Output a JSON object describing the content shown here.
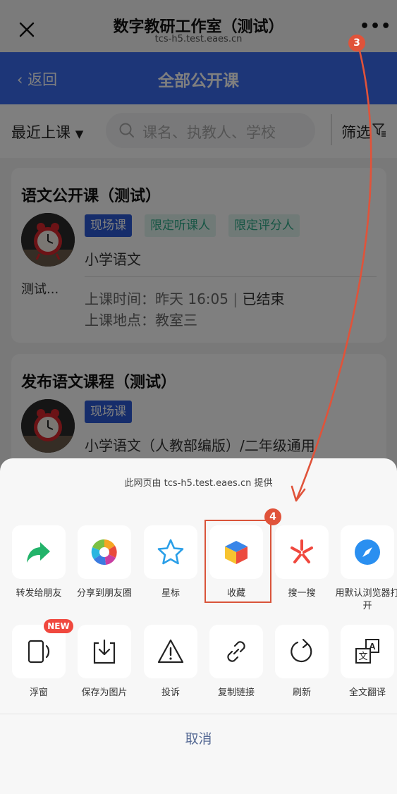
{
  "window": {
    "title": "数字教研工作室（测试）",
    "url": "tcs-h5.test.eaes.cn"
  },
  "header": {
    "back_label": "返回",
    "title": "全部公开课"
  },
  "filter_bar": {
    "sort_label": "最近上课",
    "search_placeholder": "课名、执教人、学校",
    "filter_label": "筛选"
  },
  "courses": [
    {
      "title": "语文公开课（测试）",
      "tags": [
        "现场课",
        "限定听课人",
        "限定评分人"
      ],
      "subject": "小学语文",
      "teacher": "测试...",
      "time_label": "上课时间：",
      "time_value": "昨天 16:05",
      "status": "已结束",
      "location_label": "上课地点：",
      "location_value": "教室三"
    },
    {
      "title": "发布语文课程（测试）",
      "tags": [
        "现场课"
      ],
      "subject": "小学语文（人教部编版）/二年级通用"
    }
  ],
  "share_sheet": {
    "caption": "此网页由 tcs-h5.test.eaes.cn 提供",
    "row1": [
      {
        "label": "转发给朋友",
        "icon": "forward-arrow-icon"
      },
      {
        "label": "分享到朋友圈",
        "icon": "moments-icon"
      },
      {
        "label": "星标",
        "icon": "star-icon"
      },
      {
        "label": "收藏",
        "icon": "favorite-cube-icon"
      },
      {
        "label": "搜一搜",
        "icon": "search-spark-icon"
      },
      {
        "label": "用默认浏览器打开",
        "icon": "compass-icon"
      }
    ],
    "row2": [
      {
        "label": "浮窗",
        "icon": "float-window-icon"
      },
      {
        "label": "保存为图片",
        "icon": "save-image-icon"
      },
      {
        "label": "投诉",
        "icon": "warning-icon"
      },
      {
        "label": "复制链接",
        "icon": "link-icon"
      },
      {
        "label": "刷新",
        "icon": "refresh-icon"
      },
      {
        "label": "全文翻译",
        "icon": "translate-icon"
      }
    ],
    "new_badge": "NEW",
    "cancel_label": "取消"
  },
  "annotations": {
    "step3": "3",
    "step4": "4"
  },
  "colors": {
    "header_blue": "#3a6df0",
    "tag_blue": "#2d5bd6",
    "tag_green": "#2eaa88",
    "annotation_red": "#e0533a",
    "cancel_text": "#576b95"
  }
}
